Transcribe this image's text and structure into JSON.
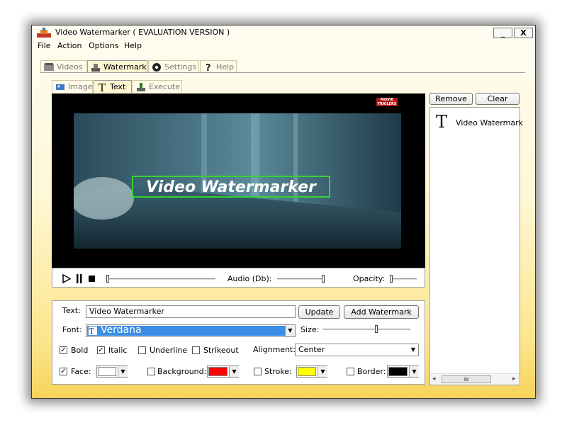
{
  "window": {
    "title": "Video Watermarker ( EVALUATION VERSION )",
    "minimize_label": "_",
    "close_label": "X"
  },
  "menu": [
    "File",
    "Action",
    "Options",
    "Help"
  ],
  "main_tabs": [
    "Videos",
    "Watermark",
    "Settings",
    "Help"
  ],
  "sub_tabs": [
    "Image",
    "Text",
    "Execute"
  ],
  "preview": {
    "watermark_text": "Video Watermarker",
    "corner_logo": "MOVIE TRAILERS"
  },
  "player": {
    "audio_label": "Audio (Db):",
    "opacity_label": "Opacity:"
  },
  "text_panel": {
    "text_label": "Text:",
    "text_value": "Video Watermarker",
    "update_button": "Update",
    "add_button": "Add Watermark",
    "font_label": "Font:",
    "font_value": "Verdana",
    "size_label": "Size:",
    "bold_label": "Bold",
    "italic_label": "Italic",
    "underline_label": "Underline",
    "strikeout_label": "Strikeout",
    "alignment_label": "Alignment:",
    "alignment_value": "Center",
    "face_label": "Face:",
    "background_label": "Background:",
    "stroke_label": "Stroke:",
    "border_label": "Border:",
    "colors": {
      "face": "#ffffff",
      "background": "#ff0000",
      "stroke": "#ffff00",
      "border": "#000000"
    },
    "checked": {
      "bold": true,
      "italic": true,
      "underline": false,
      "strikeout": false,
      "face": true,
      "background": false,
      "stroke": false,
      "border": false
    }
  },
  "list_panel": {
    "remove_button": "Remove",
    "clear_button": "Clear",
    "items": [
      "Video Watermark"
    ],
    "hscroll_grip": "III"
  }
}
